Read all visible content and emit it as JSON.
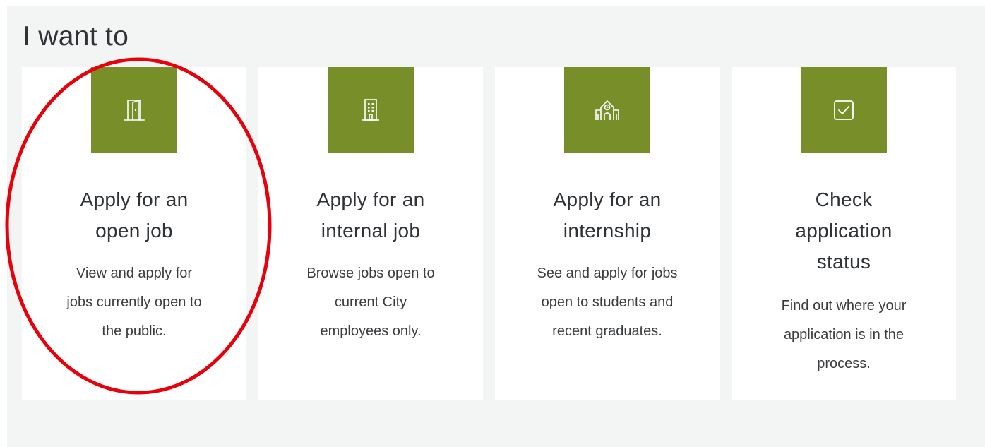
{
  "section": {
    "title": "I want to"
  },
  "colors": {
    "accent": "#788f29",
    "panel_background": "#f3f4f4",
    "card_background": "#ffffff",
    "highlight_ring": "#e8000b"
  },
  "cards": [
    {
      "icon": "door-icon",
      "title_line1": "Apply for an",
      "title_line2": "open job",
      "desc_line1": "View and apply for",
      "desc_line2": "jobs currently open to",
      "desc_line3": "the public."
    },
    {
      "icon": "office-building-icon",
      "title_line1": "Apply for an",
      "title_line2": "internal job",
      "desc_line1": "Browse jobs open to",
      "desc_line2": "current City",
      "desc_line3": "employees only."
    },
    {
      "icon": "school-building-icon",
      "title_line1": "Apply for an",
      "title_line2": "internship",
      "desc_line1": "See and apply for jobs",
      "desc_line2": "open to students and",
      "desc_line3": "recent graduates."
    },
    {
      "icon": "checkbox-icon",
      "title_line1": "Check",
      "title_line2": "application",
      "title_line3": "status",
      "desc_line1": "Find out where your",
      "desc_line2": "application is in the",
      "desc_line3": "process."
    }
  ]
}
